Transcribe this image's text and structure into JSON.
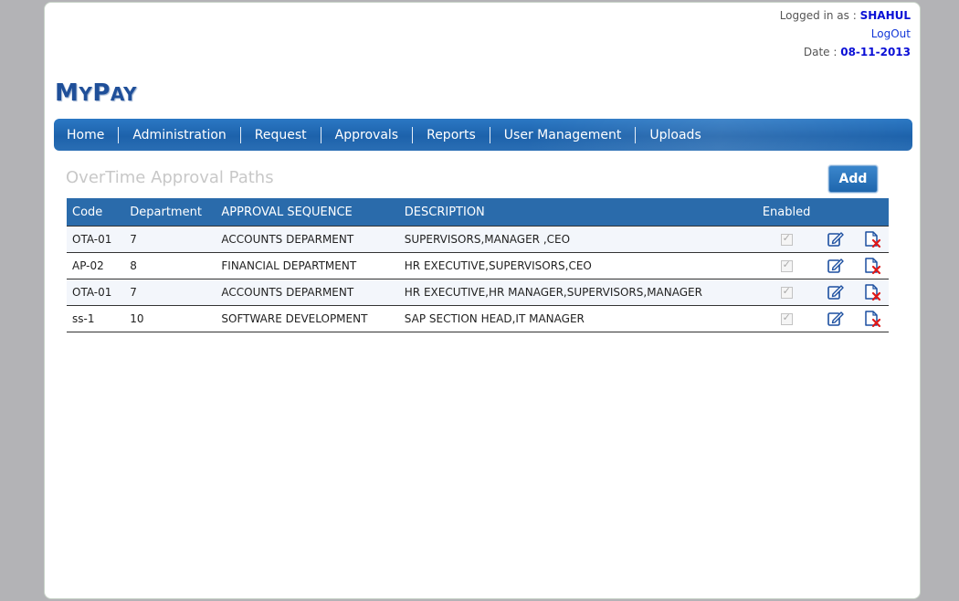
{
  "header": {
    "logged_in_label": "Logged in as : ",
    "user_name": "SHAHUL",
    "logout_label": "LogOut",
    "date_label": "Date : ",
    "date_value": "08-11-2013"
  },
  "logo": {
    "m": "M",
    "y": "Y",
    "p": "P",
    "ay": "AY"
  },
  "nav": {
    "items": [
      "Home",
      "Administration",
      "Request",
      "Approvals",
      "Reports",
      "User Management",
      "Uploads"
    ]
  },
  "page": {
    "title": "OverTime Approval Paths",
    "add_label": "Add"
  },
  "table": {
    "headers": {
      "code": "Code",
      "department": "Department",
      "sequence": "APPROVAL SEQUENCE",
      "description": "DESCRIPTION",
      "enabled": "Enabled"
    },
    "rows": [
      {
        "code": "OTA-01",
        "department": "7",
        "sequence": "ACCOUNTS DEPARMENT",
        "description": "SUPERVISORS,MANAGER ,CEO",
        "enabled": true
      },
      {
        "code": "AP-02",
        "department": "8",
        "sequence": "FINANCIAL DEPARTMENT",
        "description": "HR EXECUTIVE,SUPERVISORS,CEO",
        "enabled": true
      },
      {
        "code": "OTA-01",
        "department": "7",
        "sequence": "ACCOUNTS DEPARMENT",
        "description": "HR EXECUTIVE,HR MANAGER,SUPERVISORS,MANAGER",
        "enabled": true
      },
      {
        "code": "ss-1",
        "department": "10",
        "sequence": "SOFTWARE DEVELOPMENT",
        "description": "SAP SECTION HEAD,IT MANAGER",
        "enabled": true
      }
    ]
  },
  "colors": {
    "accent": "#2a6bab",
    "user_value": "#0a0fd6",
    "logo": "#1f4f99",
    "delete_x": "#e01818"
  },
  "icons": {
    "edit": "edit-icon",
    "delete": "delete-icon",
    "checkbox": "checkbox-icon"
  }
}
